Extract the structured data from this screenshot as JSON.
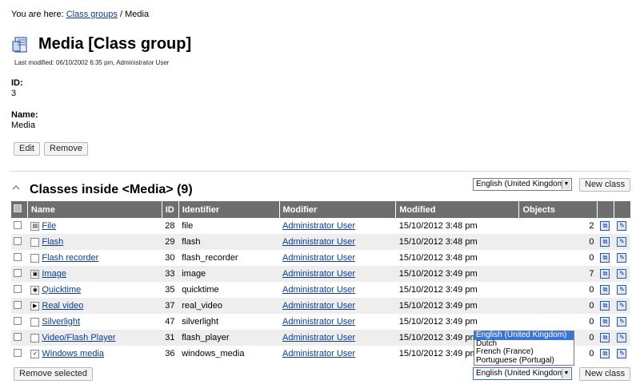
{
  "breadcrumb": {
    "prefix": "You are here:",
    "link": "Class groups",
    "separator": "/",
    "current": "Media"
  },
  "title": "Media [Class group]",
  "last_modified": "Last modified: 06/10/2002 6:35 pm, Administrator User",
  "fields": {
    "id_label": "ID:",
    "id_value": "3",
    "name_label": "Name:",
    "name_value": "Media"
  },
  "buttons": {
    "edit": "Edit",
    "remove": "Remove",
    "new_class": "New class",
    "remove_selected": "Remove selected"
  },
  "section_title": "Classes inside <Media> (9)",
  "language_select": {
    "selected": "English (United Kingdom)",
    "options": [
      "English (United Kingdom)",
      "Dutch",
      "French (France)",
      "Portuguese (Portugal)"
    ]
  },
  "table": {
    "headers": {
      "name": "Name",
      "id": "ID",
      "identifier": "Identifier",
      "modifier": "Modifier",
      "modified": "Modified",
      "objects": "Objects"
    },
    "rows": [
      {
        "name": "File",
        "id": "28",
        "identifier": "file",
        "modifier": "Administrator User",
        "modified": "15/10/2012 3:48 pm",
        "objects": "2",
        "icon": "file-icon"
      },
      {
        "name": "Flash",
        "id": "29",
        "identifier": "flash",
        "modifier": "Administrator User",
        "modified": "15/10/2012 3:48 pm",
        "objects": "0",
        "icon": "page-icon"
      },
      {
        "name": "Flash recorder",
        "id": "30",
        "identifier": "flash_recorder",
        "modifier": "Administrator User",
        "modified": "15/10/2012 3:48 pm",
        "objects": "0",
        "icon": "page-icon"
      },
      {
        "name": "Image",
        "id": "33",
        "identifier": "image",
        "modifier": "Administrator User",
        "modified": "15/10/2012 3:49 pm",
        "objects": "7",
        "icon": "image-icon"
      },
      {
        "name": "Quicktime",
        "id": "35",
        "identifier": "quicktime",
        "modifier": "Administrator User",
        "modified": "15/10/2012 3:49 pm",
        "objects": "0",
        "icon": "quicktime-icon"
      },
      {
        "name": "Real video",
        "id": "37",
        "identifier": "real_video",
        "modifier": "Administrator User",
        "modified": "15/10/2012 3:49 pm",
        "objects": "0",
        "icon": "video-icon"
      },
      {
        "name": "Silverlight",
        "id": "47",
        "identifier": "silverlight",
        "modifier": "Administrator User",
        "modified": "15/10/2012 3:49 pm",
        "objects": "0",
        "icon": "page-icon"
      },
      {
        "name": "Video/Flash Player",
        "id": "31",
        "identifier": "flash_player",
        "modifier": "Administrator User",
        "modified": "15/10/2012 3:49 pm",
        "objects": "0",
        "icon": "page-icon"
      },
      {
        "name": "Windows media",
        "id": "36",
        "identifier": "windows_media",
        "modifier": "Administrator User",
        "modified": "15/10/2012 3:49 pm",
        "objects": "0",
        "icon": "windows-media-icon"
      }
    ]
  }
}
